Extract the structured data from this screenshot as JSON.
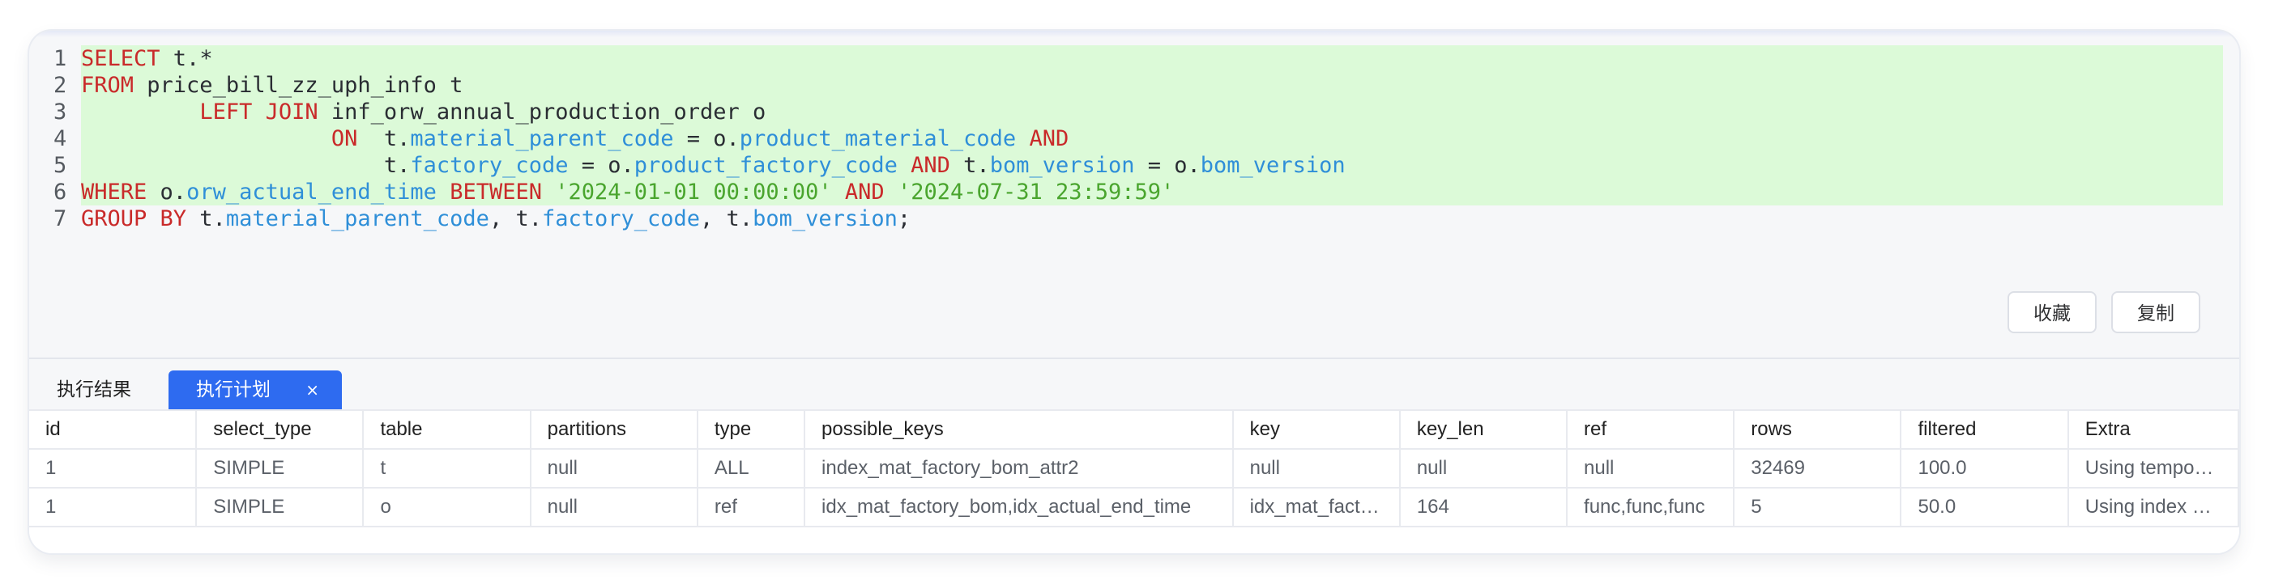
{
  "editor": {
    "lines": [
      {
        "n": "1",
        "parts": [
          [
            "kw",
            "SELECT"
          ],
          [
            "id",
            " t.*"
          ]
        ]
      },
      {
        "n": "2",
        "parts": [
          [
            "kw",
            "FROM"
          ],
          [
            "id",
            " price_bill_zz_uph_info t"
          ]
        ]
      },
      {
        "n": "3",
        "parts": [
          [
            "id",
            "         "
          ],
          [
            "kw",
            "LEFT JOIN"
          ],
          [
            "id",
            " inf_orw_annual_production_order o"
          ]
        ]
      },
      {
        "n": "4",
        "parts": [
          [
            "id",
            "                   "
          ],
          [
            "kw",
            "ON"
          ],
          [
            "id",
            "  t."
          ],
          [
            "fld",
            "material_parent_code"
          ],
          [
            "op",
            " = o."
          ],
          [
            "fld",
            "product_material_code"
          ],
          [
            "id",
            " "
          ],
          [
            "kw",
            "AND"
          ]
        ]
      },
      {
        "n": "5",
        "parts": [
          [
            "id",
            "                       t."
          ],
          [
            "fld",
            "factory_code"
          ],
          [
            "op",
            " = o."
          ],
          [
            "fld",
            "product_factory_code"
          ],
          [
            "id",
            " "
          ],
          [
            "kw",
            "AND"
          ],
          [
            "id",
            " t."
          ],
          [
            "fld",
            "bom_version"
          ],
          [
            "op",
            " = o."
          ],
          [
            "fld",
            "bom_version"
          ]
        ]
      },
      {
        "n": "6",
        "parts": [
          [
            "kw",
            "WHERE"
          ],
          [
            "id",
            " o."
          ],
          [
            "fld",
            "orw_actual_end_time"
          ],
          [
            "id",
            " "
          ],
          [
            "kw",
            "BETWEEN"
          ],
          [
            "id",
            " "
          ],
          [
            "str",
            "'2024-01-01 00:00:00'"
          ],
          [
            "id",
            " "
          ],
          [
            "kw",
            "AND"
          ],
          [
            "id",
            " "
          ],
          [
            "str",
            "'2024-07-31 23:59:59'"
          ]
        ]
      },
      {
        "n": "7",
        "parts": [
          [
            "kw",
            "GROUP BY"
          ],
          [
            "id",
            " t."
          ],
          [
            "fld",
            "material_parent_code"
          ],
          [
            "id",
            ", t."
          ],
          [
            "fld",
            "factory_code"
          ],
          [
            "id",
            ", t."
          ],
          [
            "fld",
            "bom_version"
          ],
          [
            "id",
            ";"
          ]
        ]
      }
    ]
  },
  "actions": {
    "favorite_label": "收藏",
    "copy_label": "复制"
  },
  "tabs": {
    "result_label": "执行结果",
    "plan_label": "执行计划",
    "close_glyph": "×"
  },
  "table": {
    "columns": [
      "id",
      "select_type",
      "table",
      "partitions",
      "type",
      "possible_keys",
      "key",
      "key_len",
      "ref",
      "rows",
      "filtered",
      "Extra"
    ],
    "rows": [
      [
        "1",
        "SIMPLE",
        "t",
        "null",
        "ALL",
        "index_mat_factory_bom_attr2",
        "null",
        "null",
        "null",
        "32469",
        "100.0",
        "Using tempo…"
      ],
      [
        "1",
        "SIMPLE",
        "o",
        "null",
        "ref",
        "idx_mat_factory_bom,idx_actual_end_time",
        "idx_mat_fact…",
        "164",
        "func,func,func",
        "5",
        "50.0",
        "Using index …"
      ]
    ]
  },
  "colors": {
    "highlight": "#dcfad8",
    "keyword": "#c92a2a",
    "field": "#2f8fd8",
    "string": "#4aa52e",
    "active_tab": "#2e6bf0"
  }
}
